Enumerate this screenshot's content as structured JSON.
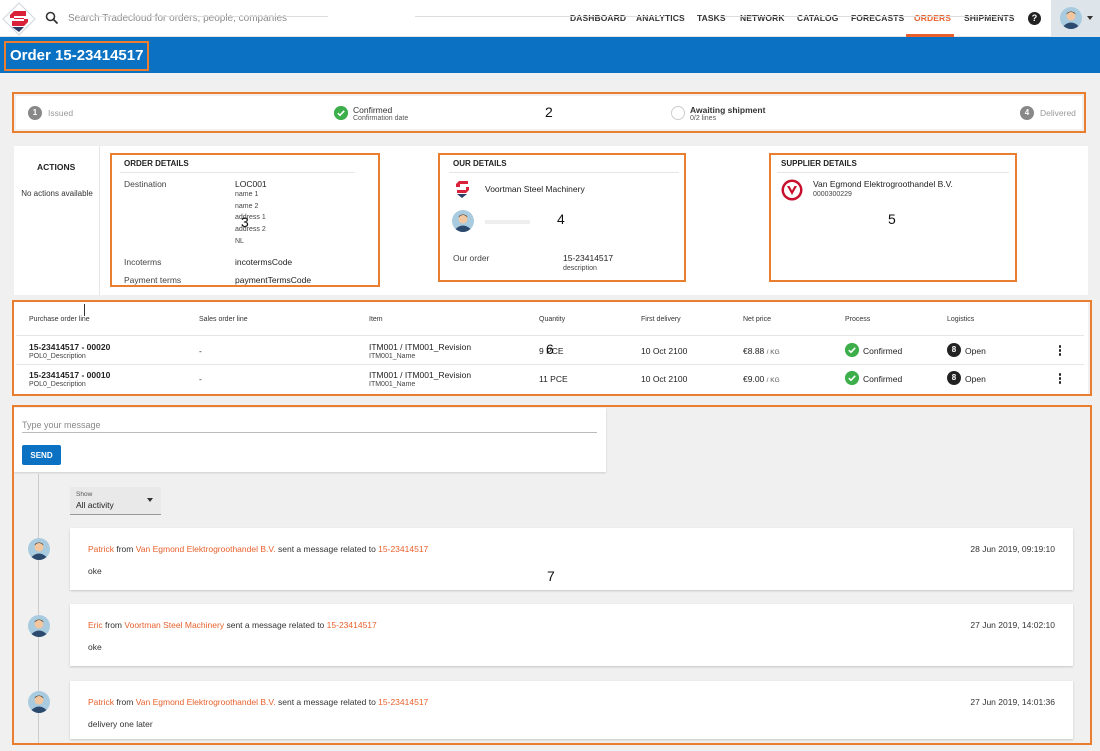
{
  "search": {
    "placeholder": "Search Tradecloud for orders, people, companies"
  },
  "nav": {
    "items": [
      "DASHBOARD",
      "ANALYTICS",
      "TASKS",
      "NETWORK",
      "CATALOG",
      "FORECASTS",
      "ORDERS",
      "SHIPMENTS"
    ],
    "active": "ORDERS",
    "help": "?"
  },
  "order": {
    "title": "Order 15-23414517"
  },
  "progress": {
    "steps": [
      {
        "num": "1",
        "label": "Issued",
        "sub": ""
      },
      {
        "num": "",
        "label": "Confirmed",
        "sub": "Confirmation date"
      },
      {
        "num": "",
        "label": "Awaiting shipment",
        "sub": "0/2 lines"
      },
      {
        "num": "4",
        "label": "Delivered",
        "sub": ""
      }
    ]
  },
  "actions": {
    "title": "ACTIONS",
    "text": "No actions available"
  },
  "order_details": {
    "title": "ORDER DETAILS",
    "destination_label": "Destination",
    "destination": "LOC001",
    "address_lines": [
      "name 1",
      "name 2",
      "address 1",
      "address 2",
      "NL"
    ],
    "incoterms_label": "Incoterms",
    "incoterms": "incotermsCode",
    "payment_label": "Payment terms",
    "payment": "paymentTermsCode"
  },
  "our_details": {
    "title": "OUR DETAILS",
    "company": "Voortman Steel Machinery",
    "our_order_label": "Our order",
    "our_order": "15-23414517",
    "our_order_desc": "description"
  },
  "supplier_details": {
    "title": "SUPPLIER DETAILS",
    "company": "Van Egmond Elektrogroothandel B.V.",
    "code": "0000300229"
  },
  "lines": {
    "headers": [
      "Purchase order line",
      "Sales order line",
      "Item",
      "Quantity",
      "First delivery",
      "Net price",
      "Process",
      "Logistics"
    ],
    "rows": [
      {
        "po": "15-23414517 - 00020",
        "po_desc": "POL0_Description",
        "so": "-",
        "item": "ITM001 / ITM001_Revision",
        "item_name": "ITM001_Name",
        "qty": "9 PCE",
        "delivery": "10 Oct 2100",
        "price": "€8.88",
        "price_unit": "/ KG",
        "process": "Confirmed",
        "logistics": "Open",
        "logistics_icon": "8"
      },
      {
        "po": "15-23414517 - 00010",
        "po_desc": "POL0_Description",
        "so": "-",
        "item": "ITM001 / ITM001_Revision",
        "item_name": "ITM001_Name",
        "qty": "11 PCE",
        "delivery": "10 Oct 2100",
        "price": "€9.00",
        "price_unit": "/ KG",
        "process": "Confirmed",
        "logistics": "Open",
        "logistics_icon": "8"
      }
    ]
  },
  "composer": {
    "placeholder": "Type your message",
    "send": "SEND"
  },
  "filter": {
    "label": "Show",
    "value": "All activity"
  },
  "messages": [
    {
      "sender": "Patrick",
      "from_word": "from",
      "company": "Van Egmond Elektrogroothandel B.V.",
      "action": "sent a message related to",
      "ref": "15-23414517",
      "time": "28 Jun 2019, 09:19:10",
      "body": "oke"
    },
    {
      "sender": "Eric",
      "from_word": "from",
      "company": "Voortman Steel Machinery",
      "action": "sent a message related to",
      "ref": "15-23414517",
      "time": "27 Jun 2019, 14:02:10",
      "body": "oke"
    },
    {
      "sender": "Patrick",
      "from_word": "from",
      "company": "Van Egmond Elektrogroothandel B.V.",
      "action": "sent a message related to",
      "ref": "15-23414517",
      "time": "27 Jun 2019, 14:01:36",
      "body": "delivery one later"
    }
  ],
  "annotations": [
    "2",
    "3",
    "4",
    "5",
    "6",
    "7"
  ],
  "colors": {
    "brand_blue": "#0b72c3",
    "accent_orange": "#e8612c",
    "annotation": "#e87e2e",
    "ok_green": "#3cae4a"
  }
}
